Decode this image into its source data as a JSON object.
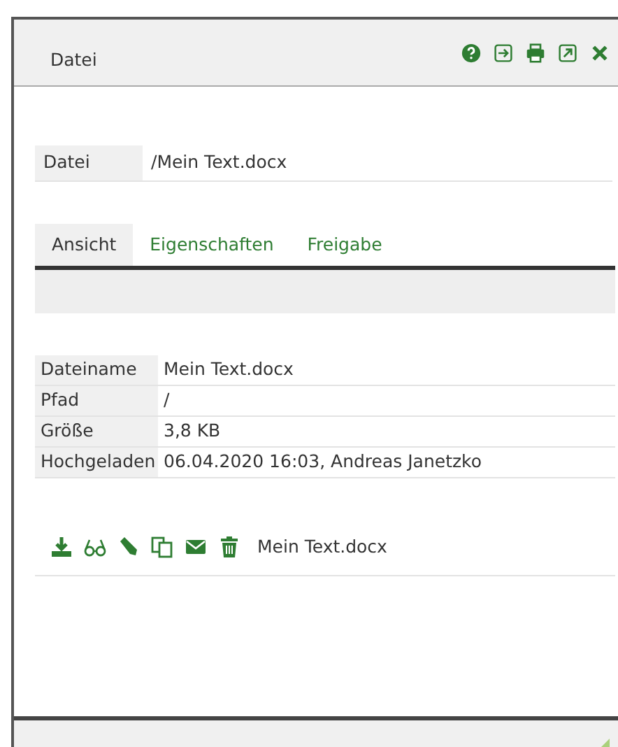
{
  "dialog": {
    "title": "Datei",
    "header_buttons": [
      {
        "kind": "help"
      },
      {
        "kind": "login"
      },
      {
        "kind": "print"
      },
      {
        "kind": "external"
      },
      {
        "kind": "close"
      }
    ]
  },
  "file_field": {
    "label": "Datei",
    "value": "/Mein Text.docx"
  },
  "tabs": [
    {
      "label": "Ansicht",
      "selected": true
    },
    {
      "label": "Eigenschaften",
      "selected": false
    },
    {
      "label": "Freigabe",
      "selected": false
    }
  ],
  "properties": [
    {
      "label": "Dateiname",
      "value": "Mein Text.docx"
    },
    {
      "label": "Pfad",
      "value": "/"
    },
    {
      "label": "Größe",
      "value": "3,8 KB"
    },
    {
      "label": "Hochgeladen",
      "value": "06.04.2020 16:03, Andreas Janetzko"
    }
  ],
  "file_actions": {
    "buttons": [
      {
        "kind": "download"
      },
      {
        "kind": "view"
      },
      {
        "kind": "edit"
      },
      {
        "kind": "copy"
      },
      {
        "kind": "mail"
      },
      {
        "kind": "delete"
      }
    ],
    "filename": "Mein Text.docx"
  }
}
